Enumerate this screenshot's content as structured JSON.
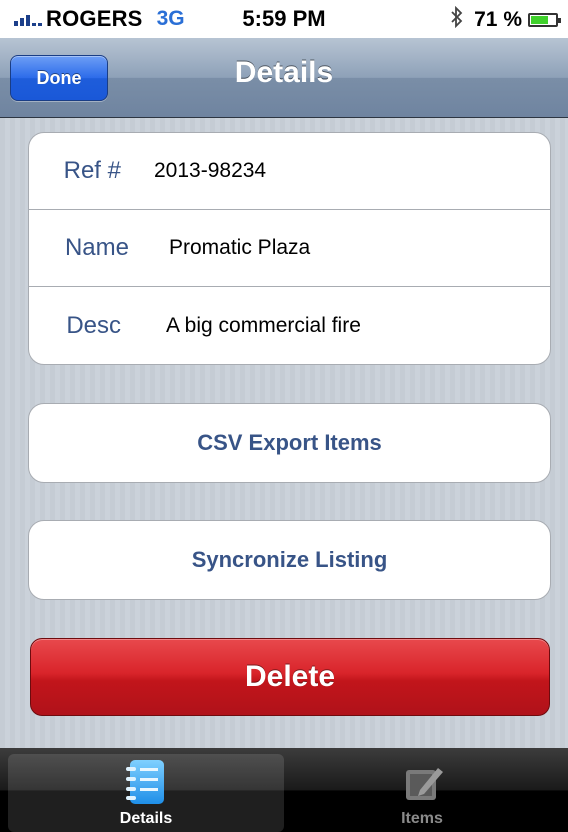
{
  "status_bar": {
    "carrier": "ROGERS",
    "network": "3G",
    "time": "5:59 PM",
    "battery_percent": "71 %",
    "battery_level": 0.71,
    "icons": [
      "signal-icon",
      "bluetooth-icon",
      "battery-icon"
    ]
  },
  "nav": {
    "done_label": "Done",
    "title": "Details"
  },
  "fields": [
    {
      "label": "Ref #",
      "value": "2013-98234"
    },
    {
      "label": "Name",
      "value": "Promatic Plaza"
    },
    {
      "label": "Desc",
      "value": "A big commercial fire"
    }
  ],
  "actions": {
    "csv_export_label": "CSV Export Items",
    "sync_label": "Syncronize Listing",
    "delete_label": "Delete"
  },
  "tabs": [
    {
      "label": "Details",
      "icon": "notebook-icon",
      "selected": true
    },
    {
      "label": "Items",
      "icon": "compose-icon",
      "selected": false
    }
  ],
  "colors": {
    "nav_bar": "#7a8ea7",
    "done_button": "#2c6bea",
    "label_blue": "#385487",
    "delete_red": "#c2151b",
    "battery_green": "#3fd12b"
  }
}
